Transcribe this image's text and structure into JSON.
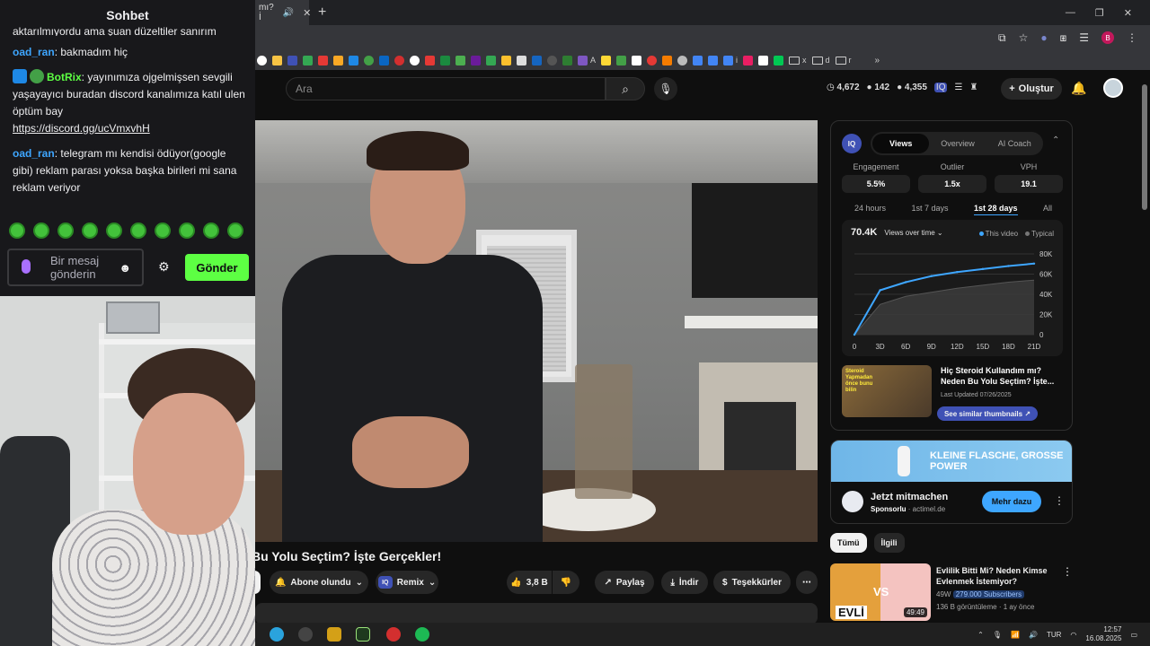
{
  "browser": {
    "tab_title": "mı? İ",
    "new_tab": "+",
    "profile_initial": "B"
  },
  "bookmark_labels": [
    "A",
    "i",
    "x",
    "d",
    "r"
  ],
  "youtube": {
    "search_placeholder": "Ara",
    "stats": {
      "a": "4,672",
      "b": "142",
      "c": "4,355"
    },
    "create_label": "Oluştur"
  },
  "video": {
    "title": "Bu Yolu Seçtim? İşte Gerçekler!",
    "subscribed_label": "Abone olundu",
    "remix_label": "Remix",
    "like_count": "3,8 B",
    "share_label": "Paylaş",
    "download_label": "İndir",
    "thanks_label": "Teşekkürler"
  },
  "vidiq": {
    "logo": "IQ",
    "tabs": [
      "Views",
      "Overview",
      "AI Coach"
    ],
    "active_tab": 0,
    "metrics": [
      {
        "label": "Engagement",
        "value": "5.5%"
      },
      {
        "label": "Outlier",
        "value": "1.5x"
      },
      {
        "label": "VPH",
        "value": "19.1"
      }
    ],
    "ranges": [
      "24 hours",
      "1st 7 days",
      "1st 28 days",
      "All"
    ],
    "active_range": 2,
    "chart_total": "70.4K",
    "chart_selector": "Views over time",
    "legend_this": "This video",
    "legend_typical": "Typical",
    "thumb_tag": "Steroid Yapmadan önce bunu bilin",
    "thumb_title": "Hiç Steroid Kullandım mı? Neden Bu Yolu Seçtim? İşte...",
    "thumb_updated": "Last Updated 07/26/2025",
    "similar_btn": "See similar thumbnails ↗"
  },
  "chart_data": {
    "type": "area",
    "title": "",
    "x": [
      0,
      3,
      6,
      9,
      12,
      15,
      18,
      21
    ],
    "x_tick_labels": [
      "0",
      "3D",
      "6D",
      "9D",
      "12D",
      "15D",
      "18D",
      "21D"
    ],
    "y_tick_labels": [
      "0",
      "20K",
      "40K",
      "60K",
      "80K"
    ],
    "ylim": [
      0,
      80000
    ],
    "series": [
      {
        "name": "This video",
        "values": [
          0,
          44000,
          52000,
          58000,
          62000,
          65000,
          68000,
          70400
        ]
      },
      {
        "name": "Typical",
        "values": [
          0,
          30000,
          38000,
          42000,
          46000,
          49000,
          52000,
          54000
        ]
      }
    ],
    "colors": {
      "this_video": "#3ea6ff",
      "typical": "#555555"
    }
  },
  "ad": {
    "headline": "KLEINE FLASCHE, GROSSE POWER",
    "title": "Jetzt mitmachen",
    "sponsor": "Sponsorlu",
    "domain": "· actimel.de",
    "cta": "Mehr dazu"
  },
  "filters": [
    "Tümü",
    "İlgili"
  ],
  "recommendation": {
    "title": "Evlilik Bitti Mi? Neden Kimse Evlenmek İstemiyor?",
    "views": "49W",
    "subscribers": "279.000 Subscribers",
    "meta2": "136 B görüntüleme · 1 ay önce",
    "duration": "49:49",
    "thumb_left": "EVLİ",
    "thumb_vs": "VS"
  },
  "chat": {
    "title": "Sohbet",
    "partial_line": "aktarılmıyordu ama şuan düzeltiler sanırım",
    "messages": [
      {
        "user": "oad_ran",
        "text": ": bakmadım hiç",
        "link": ""
      },
      {
        "user": "BotRix",
        "text": ": yayınımıza ojgelmişsen sevgili yaşayayıcı buradan discord kanalımıza katıl ulen öptüm bay",
        "link": "https://discord.gg/ucVmxvhH"
      },
      {
        "user": "oad_ran",
        "text": ": telegram mı kendisi ödüyor(google gibi) reklam parası yoksa başka birileri mi sana reklam veriyor",
        "link": ""
      }
    ],
    "input_placeholder": "Bir mesaj gönderin",
    "send_label": "Gönder"
  },
  "taskbar": {
    "lang": "TUR",
    "time": "12:57",
    "date": "16.08.2025"
  }
}
